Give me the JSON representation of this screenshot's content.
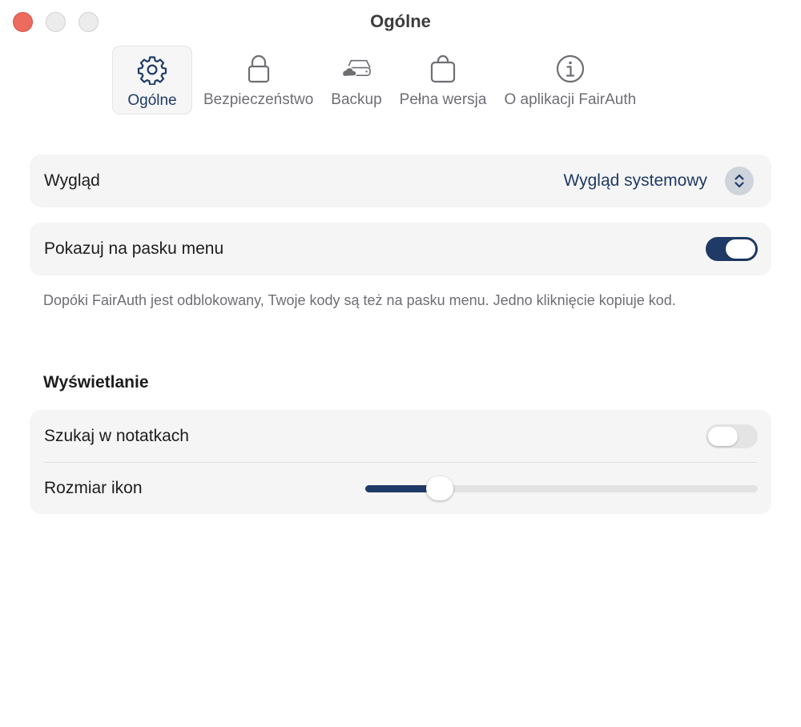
{
  "window": {
    "title": "Ogólne"
  },
  "tabs": [
    {
      "label": "Ogólne",
      "icon": "gear-icon",
      "active": true
    },
    {
      "label": "Bezpieczeństwo",
      "icon": "lock-icon",
      "active": false
    },
    {
      "label": "Backup",
      "icon": "cloud-drive-icon",
      "active": false
    },
    {
      "label": "Pełna wersja",
      "icon": "shopping-bag-icon",
      "active": false
    },
    {
      "label": "O aplikacji FairAuth",
      "icon": "info-icon",
      "active": false
    }
  ],
  "appearance": {
    "label": "Wygląd",
    "selected_value": "Wygląd systemowy"
  },
  "menu_bar": {
    "label": "Pokazuj na pasku menu",
    "enabled": true,
    "help": "Dopóki FairAuth jest odblokowany, Twoje kody są też na pasku menu. Jedno kliknięcie kopiuje kod."
  },
  "display": {
    "header": "Wyświetlanie",
    "search_notes": {
      "label": "Szukaj w notatkach",
      "enabled": false
    },
    "icon_size": {
      "label": "Rozmiar ikon",
      "fraction": 0.19
    }
  },
  "colors": {
    "accent": "#1f3a66",
    "close": "#ec6a5e",
    "card_bg": "#f5f5f5"
  }
}
